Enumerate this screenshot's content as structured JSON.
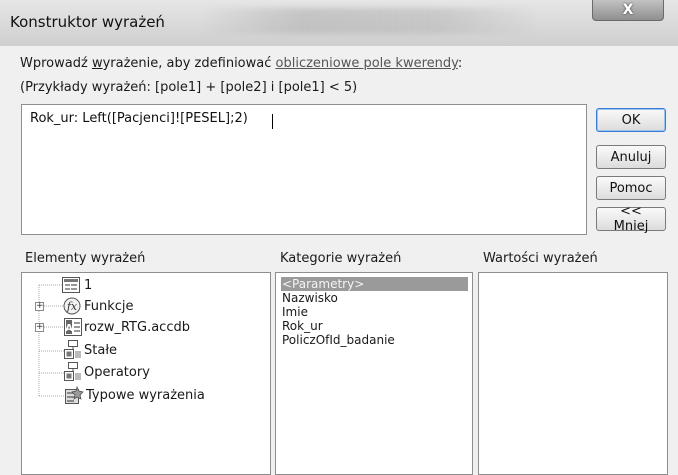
{
  "window": {
    "title": "Konstruktor wyrażeń",
    "close_label": "X"
  },
  "prompt": {
    "line1_pre": "Wprowadź ",
    "line1_u": "w",
    "line1_mid": "yrażenie, aby zdefiniować ",
    "line1_link": "obliczeniowe pole kwerendy",
    "line1_end": ":",
    "line2": "(Przykłady wyrażeń: [pole1] + [pole2] i [pole1] < 5)"
  },
  "expression": {
    "value": "Rok_ur: Left([Pacjenci]![PESEL];2)"
  },
  "buttons": {
    "ok": "OK",
    "cancel": "Anuluj",
    "help": "Pomoc",
    "less": "<< Mniej"
  },
  "sections": {
    "elements": "Elementy wyrażeń",
    "categories": "Kategorie wyrażeń",
    "values": "Wartości wyrażeń"
  },
  "tree": {
    "items": [
      {
        "label": "1",
        "icon": "form-icon"
      },
      {
        "label": "Funkcje",
        "icon": "function-icon"
      },
      {
        "label": "rozw_RTG.accdb",
        "icon": "database-icon"
      },
      {
        "label": "Stałe",
        "icon": "constant-icon"
      },
      {
        "label": "Operatory",
        "icon": "operator-icon"
      },
      {
        "label": "Typowe wyrażenia",
        "icon": "common-expression-icon"
      }
    ]
  },
  "categories": {
    "items": [
      "<Parametry>",
      "Nazwisko",
      "Imie",
      "Rok_ur",
      "PoliczOfId_badanie"
    ],
    "selected": "<Parametry>"
  },
  "colors": {
    "selection": "#9a9a9a",
    "link": "#555555"
  }
}
